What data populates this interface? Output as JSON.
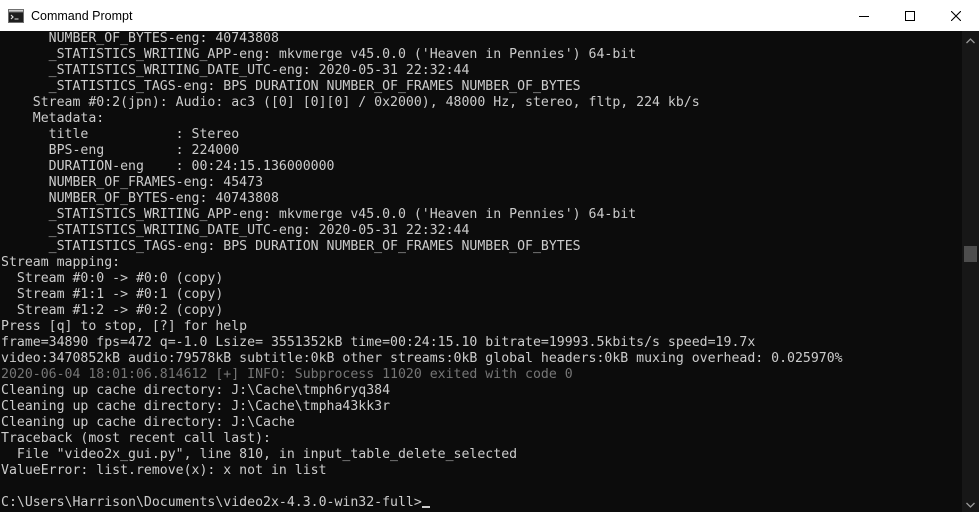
{
  "window": {
    "title": "Command Prompt"
  },
  "icons": {
    "app": "console-app-icon",
    "minimize": "minimize-icon",
    "maximize": "maximize-icon",
    "close": "close-icon",
    "scroll_up": "scroll-up-arrow-icon",
    "scroll_down": "scroll-down-arrow-icon"
  },
  "scrollbar": {
    "position_fraction": 0.46
  },
  "console": {
    "lines": [
      {
        "text": "      NUMBER_OF_BYTES-eng: 40743808",
        "dim": false
      },
      {
        "text": "      _STATISTICS_WRITING_APP-eng: mkvmerge v45.0.0 ('Heaven in Pennies') 64-bit",
        "dim": false
      },
      {
        "text": "      _STATISTICS_WRITING_DATE_UTC-eng: 2020-05-31 22:32:44",
        "dim": false
      },
      {
        "text": "      _STATISTICS_TAGS-eng: BPS DURATION NUMBER_OF_FRAMES NUMBER_OF_BYTES",
        "dim": false
      },
      {
        "text": "    Stream #0:2(jpn): Audio: ac3 ([0] [0][0] / 0x2000), 48000 Hz, stereo, fltp, 224 kb/s",
        "dim": false
      },
      {
        "text": "    Metadata:",
        "dim": false
      },
      {
        "text": "      title           : Stereo",
        "dim": false
      },
      {
        "text": "      BPS-eng         : 224000",
        "dim": false
      },
      {
        "text": "      DURATION-eng    : 00:24:15.136000000",
        "dim": false
      },
      {
        "text": "      NUMBER_OF_FRAMES-eng: 45473",
        "dim": false
      },
      {
        "text": "      NUMBER_OF_BYTES-eng: 40743808",
        "dim": false
      },
      {
        "text": "      _STATISTICS_WRITING_APP-eng: mkvmerge v45.0.0 ('Heaven in Pennies') 64-bit",
        "dim": false
      },
      {
        "text": "      _STATISTICS_WRITING_DATE_UTC-eng: 2020-05-31 22:32:44",
        "dim": false
      },
      {
        "text": "      _STATISTICS_TAGS-eng: BPS DURATION NUMBER_OF_FRAMES NUMBER_OF_BYTES",
        "dim": false
      },
      {
        "text": "Stream mapping:",
        "dim": false
      },
      {
        "text": "  Stream #0:0 -> #0:0 (copy)",
        "dim": false
      },
      {
        "text": "  Stream #1:1 -> #0:1 (copy)",
        "dim": false
      },
      {
        "text": "  Stream #1:2 -> #0:2 (copy)",
        "dim": false
      },
      {
        "text": "Press [q] to stop, [?] for help",
        "dim": false
      },
      {
        "text": "frame=34890 fps=472 q=-1.0 Lsize= 3551352kB time=00:24:15.10 bitrate=19993.5kbits/s speed=19.7x",
        "dim": false
      },
      {
        "text": "video:3470852kB audio:79578kB subtitle:0kB other streams:0kB global headers:0kB muxing overhead: 0.025970%",
        "dim": false
      },
      {
        "text": "2020-06-04 18:01:06.814612 [+] INFO: Subprocess 11020 exited with code 0",
        "dim": true
      },
      {
        "text": "Cleaning up cache directory: J:\\Cache\\tmph6ryq384",
        "dim": false
      },
      {
        "text": "Cleaning up cache directory: J:\\Cache\\tmpha43kk3r",
        "dim": false
      },
      {
        "text": "Cleaning up cache directory: J:\\Cache",
        "dim": false
      },
      {
        "text": "Traceback (most recent call last):",
        "dim": false
      },
      {
        "text": "  File \"video2x_gui.py\", line 810, in input_table_delete_selected",
        "dim": false
      },
      {
        "text": "ValueError: list.remove(x): x not in list",
        "dim": false
      },
      {
        "text": "",
        "dim": false
      },
      {
        "text": "C:\\Users\\Harrison\\Documents\\video2x-4.3.0-win32-full>",
        "dim": false,
        "prompt": true
      }
    ]
  }
}
